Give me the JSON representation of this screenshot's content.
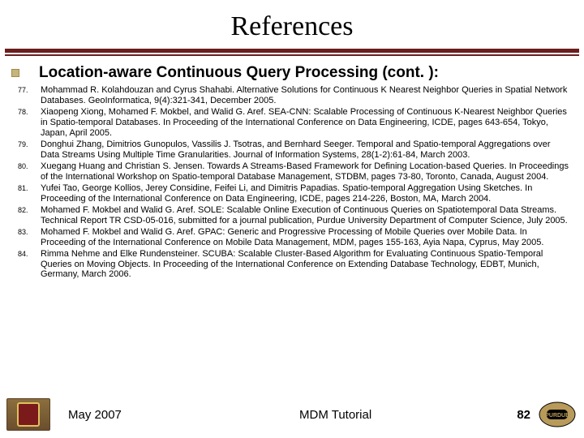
{
  "title": "References",
  "heading": "Location-aware Continuous Query Processing (cont. ):",
  "references": [
    {
      "num": "77.",
      "text": "Mohammad R. Kolahdouzan and Cyrus Shahabi. Alternative Solutions for Continuous K Nearest Neighbor Queries in Spatial Network Databases. GeoInformatica, 9(4):321-341, December 2005."
    },
    {
      "num": "78.",
      "text": "Xiaopeng Xiong, Mohamed F. Mokbel, and Walid G. Aref. SEA-CNN: Scalable Processing of Continuous K-Nearest Neighbor Queries in Spatio-temporal Databases. In Proceeding of the International Conference on Data Engineering, ICDE, pages 643-654, Tokyo, Japan, April 2005."
    },
    {
      "num": "79.",
      "text": "Donghui Zhang, Dimitrios Gunopulos, Vassilis J. Tsotras, and Bernhard Seeger. Temporal and Spatio-temporal Aggregations over Data Streams Using Multiple Time Granularities. Journal of Information Systems, 28(1-2):61-84, March 2003."
    },
    {
      "num": "80.",
      "text": "Xuegang Huang and Christian S. Jensen. Towards A Streams-Based Framework for Defining Location-based Queries. In Proceedings of the International Workshop on Spatio-temporal Database Management, STDBM, pages 73-80, Toronto, Canada, August 2004."
    },
    {
      "num": "81.",
      "text": "Yufei Tao, George Kollios, Jerey Considine, Feifei Li, and Dimitris Papadias. Spatio-temporal Aggregation Using Sketches. In Proceeding of the International Conference on Data Engineering, ICDE, pages 214-226, Boston, MA, March 2004."
    },
    {
      "num": "82.",
      "text": "Mohamed F. Mokbel and Walid G. Aref. SOLE: Scalable Online Execution of Continuous Queries on Spatiotemporal Data Streams. Technical Report TR CSD-05-016, submitted for a journal publication, Purdue University Department of Computer Science, July 2005."
    },
    {
      "num": "83.",
      "text": "Mohamed F. Mokbel and Walid G. Aref. GPAC: Generic and Progressive Processing of Mobile Queries over Mobile Data. In Proceeding of the International Conference on Mobile Data Management, MDM, pages 155-163, Ayia Napa, Cyprus, May 2005."
    },
    {
      "num": "84.",
      "text": "Rimma Nehme and Elke Rundensteiner. SCUBA: Scalable Cluster-Based Algorithm for Evaluating Continuous Spatio-Temporal Queries on Moving Objects. In Proceeding of the International Conference on Extending Database Technology, EDBT, Munich, Germany, March 2006."
    }
  ],
  "footer": {
    "date": "May 2007",
    "center": "MDM Tutorial",
    "page": "82"
  }
}
